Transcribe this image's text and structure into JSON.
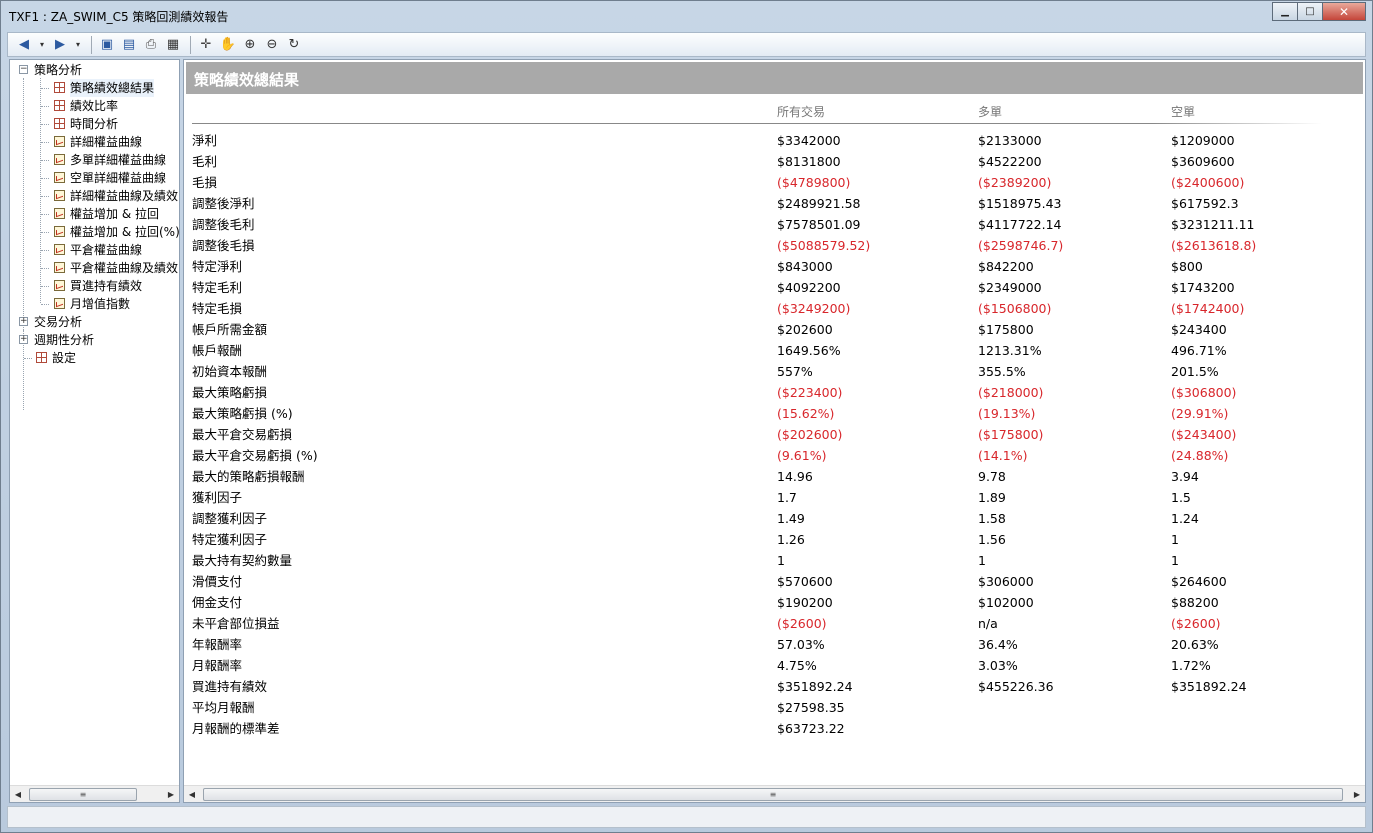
{
  "window": {
    "title": "TXF1 : ZA_SWIM_C5 策略回測績效報告",
    "minimize_label": "▁",
    "maximize_label": "□",
    "close_label": "✕"
  },
  "toolbar": {
    "buttons": [
      "back-icon",
      "dropdown-icon",
      "forward-icon",
      "dropdown-icon",
      "save-icon",
      "preview-icon",
      "print-icon",
      "table-icon",
      "crosshair-icon",
      "hand-icon",
      "zoom-in-icon",
      "zoom-out-icon",
      "refresh-icon"
    ]
  },
  "tree": {
    "nodes": [
      {
        "label": "策略分析",
        "level": 0,
        "expander": "−",
        "icon": "none"
      },
      {
        "label": "策略績效總結果",
        "level": 1,
        "icon": "grid",
        "selected": true
      },
      {
        "label": "績效比率",
        "level": 1,
        "icon": "grid"
      },
      {
        "label": "時間分析",
        "level": 1,
        "icon": "grid"
      },
      {
        "label": "詳細權益曲線",
        "level": 1,
        "icon": "chart"
      },
      {
        "label": "多單詳細權益曲線",
        "level": 1,
        "icon": "chart"
      },
      {
        "label": "空單詳細權益曲線",
        "level": 1,
        "icon": "chart"
      },
      {
        "label": "詳細權益曲線及績效",
        "level": 1,
        "icon": "chart"
      },
      {
        "label": "權益增加 & 拉回",
        "level": 1,
        "icon": "chart"
      },
      {
        "label": "權益增加 & 拉回(%)",
        "level": 1,
        "icon": "chart"
      },
      {
        "label": "平倉權益曲線",
        "level": 1,
        "icon": "chart"
      },
      {
        "label": "平倉權益曲線及績效",
        "level": 1,
        "icon": "chart"
      },
      {
        "label": "買進持有績效",
        "level": 1,
        "icon": "chart"
      },
      {
        "label": "月增值指數",
        "level": 1,
        "icon": "chart"
      },
      {
        "label": "交易分析",
        "level": 0,
        "expander": "+",
        "icon": "none"
      },
      {
        "label": "週期性分析",
        "level": 0,
        "expander": "+",
        "icon": "none"
      },
      {
        "label": "設定",
        "level": 0,
        "icon": "grid"
      }
    ]
  },
  "report": {
    "title": "策略績效總結果",
    "columns": [
      "所有交易",
      "多單",
      "空單"
    ],
    "rows": [
      {
        "label": "淨利",
        "values": [
          "$3342000",
          "$2133000",
          "$1209000"
        ],
        "neg": [
          false,
          false,
          false
        ]
      },
      {
        "label": "毛利",
        "values": [
          "$8131800",
          "$4522200",
          "$3609600"
        ],
        "neg": [
          false,
          false,
          false
        ]
      },
      {
        "label": "毛損",
        "values": [
          "($4789800)",
          "($2389200)",
          "($2400600)"
        ],
        "neg": [
          true,
          true,
          true
        ]
      },
      {
        "label": "調整後淨利",
        "values": [
          "$2489921.58",
          "$1518975.43",
          "$617592.3"
        ],
        "neg": [
          false,
          false,
          false
        ]
      },
      {
        "label": "調整後毛利",
        "values": [
          "$7578501.09",
          "$4117722.14",
          "$3231211.11"
        ],
        "neg": [
          false,
          false,
          false
        ]
      },
      {
        "label": "調整後毛損",
        "values": [
          "($5088579.52)",
          "($2598746.7)",
          "($2613618.8)"
        ],
        "neg": [
          true,
          true,
          true
        ]
      },
      {
        "label": "特定淨利",
        "values": [
          "$843000",
          "$842200",
          "$800"
        ],
        "neg": [
          false,
          false,
          false
        ]
      },
      {
        "label": "特定毛利",
        "values": [
          "$4092200",
          "$2349000",
          "$1743200"
        ],
        "neg": [
          false,
          false,
          false
        ]
      },
      {
        "label": "特定毛損",
        "values": [
          "($3249200)",
          "($1506800)",
          "($1742400)"
        ],
        "neg": [
          true,
          true,
          true
        ]
      },
      {
        "label": "帳戶所需金額",
        "values": [
          "$202600",
          "$175800",
          "$243400"
        ],
        "neg": [
          false,
          false,
          false
        ]
      },
      {
        "label": "帳戶報酬",
        "values": [
          "1649.56%",
          "1213.31%",
          "496.71%"
        ],
        "neg": [
          false,
          false,
          false
        ]
      },
      {
        "label": "初始資本報酬",
        "values": [
          "557%",
          "355.5%",
          "201.5%"
        ],
        "neg": [
          false,
          false,
          false
        ]
      },
      {
        "label": "最大策略虧損",
        "values": [
          "($223400)",
          "($218000)",
          "($306800)"
        ],
        "neg": [
          true,
          true,
          true
        ]
      },
      {
        "label": "最大策略虧損 (%)",
        "values": [
          "(15.62%)",
          "(19.13%)",
          "(29.91%)"
        ],
        "neg": [
          true,
          true,
          true
        ]
      },
      {
        "label": "最大平倉交易虧損",
        "values": [
          "($202600)",
          "($175800)",
          "($243400)"
        ],
        "neg": [
          true,
          true,
          true
        ]
      },
      {
        "label": "最大平倉交易虧損 (%)",
        "values": [
          "(9.61%)",
          "(14.1%)",
          "(24.88%)"
        ],
        "neg": [
          true,
          true,
          true
        ]
      },
      {
        "label": "最大的策略虧損報酬",
        "values": [
          "14.96",
          "9.78",
          "3.94"
        ],
        "neg": [
          false,
          false,
          false
        ]
      },
      {
        "label": "獲利因子",
        "values": [
          "1.7",
          "1.89",
          "1.5"
        ],
        "neg": [
          false,
          false,
          false
        ]
      },
      {
        "label": "調整獲利因子",
        "values": [
          "1.49",
          "1.58",
          "1.24"
        ],
        "neg": [
          false,
          false,
          false
        ]
      },
      {
        "label": "特定獲利因子",
        "values": [
          "1.26",
          "1.56",
          "1"
        ],
        "neg": [
          false,
          false,
          false
        ]
      },
      {
        "label": "最大持有契約數量",
        "values": [
          "1",
          "1",
          "1"
        ],
        "neg": [
          false,
          false,
          false
        ]
      },
      {
        "label": "滑價支付",
        "values": [
          "$570600",
          "$306000",
          "$264600"
        ],
        "neg": [
          false,
          false,
          false
        ]
      },
      {
        "label": "佣金支付",
        "values": [
          "$190200",
          "$102000",
          "$88200"
        ],
        "neg": [
          false,
          false,
          false
        ]
      },
      {
        "label": "未平倉部位損益",
        "values": [
          "($2600)",
          "n/a",
          "($2600)"
        ],
        "neg": [
          true,
          false,
          true
        ]
      },
      {
        "label": "年報酬率",
        "values": [
          "57.03%",
          "36.4%",
          "20.63%"
        ],
        "neg": [
          false,
          false,
          false
        ]
      },
      {
        "label": "月報酬率",
        "values": [
          "4.75%",
          "3.03%",
          "1.72%"
        ],
        "neg": [
          false,
          false,
          false
        ]
      },
      {
        "label": "買進持有績效",
        "values": [
          "$351892.24",
          "$455226.36",
          "$351892.24"
        ],
        "neg": [
          false,
          false,
          false
        ]
      },
      {
        "label": "平均月報酬",
        "values": [
          "$27598.35",
          "",
          ""
        ],
        "neg": [
          false,
          false,
          false
        ]
      },
      {
        "label": "月報酬的標準差",
        "values": [
          "$63723.22",
          "",
          ""
        ],
        "neg": [
          false,
          false,
          false
        ]
      }
    ]
  },
  "colors": {
    "negative": "#d8262b",
    "header_bar": "#a9a9a9",
    "column_header": "#777777"
  }
}
